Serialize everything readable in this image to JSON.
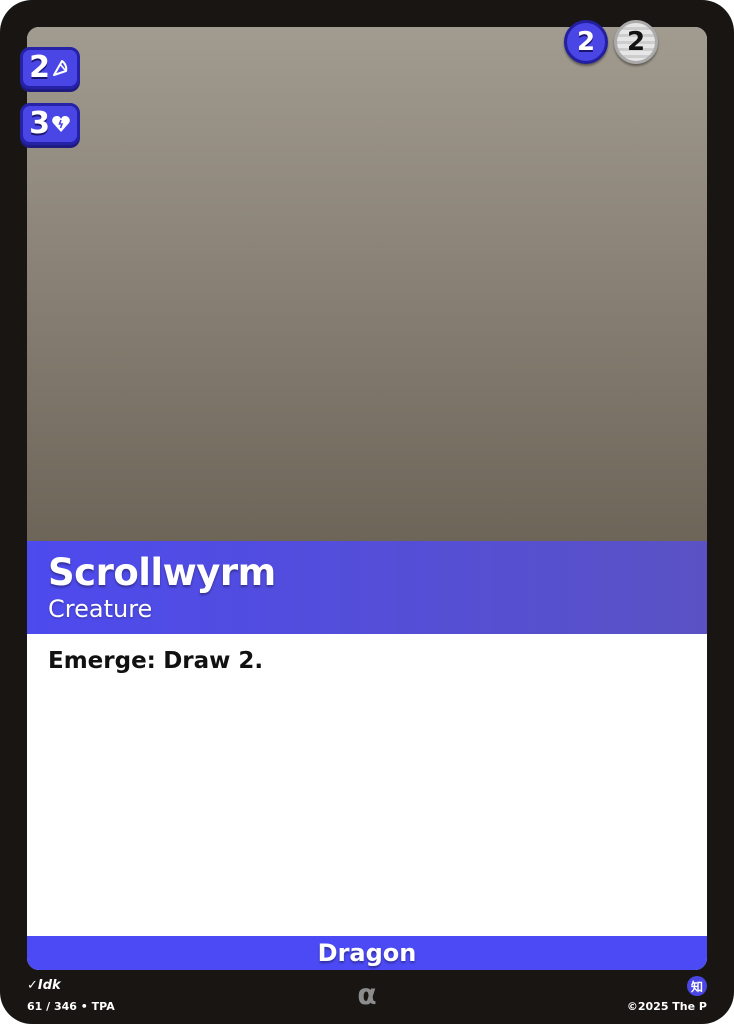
{
  "card": {
    "name": "Scrollwyrm",
    "type": "Creature",
    "rules_keyword": "Emerge:",
    "rules_text": "Draw 2.",
    "subtype": "Dragon"
  },
  "stats": {
    "power": "2",
    "power_icon": "power-icon",
    "health": "3",
    "health_icon": "health-icon"
  },
  "cost": {
    "colored": "2",
    "generic": "2"
  },
  "footer": {
    "artist": "Idk",
    "set_info": "61 / 346 • TPA",
    "rarity": "α",
    "mark": "知",
    "copyright": "©2025 The P"
  },
  "colors": {
    "frame": "#181512",
    "accent": "#4b4af5",
    "accent_dark": "#2622a8",
    "art_top": "#a19b90",
    "art_bottom": "#6d6558"
  }
}
